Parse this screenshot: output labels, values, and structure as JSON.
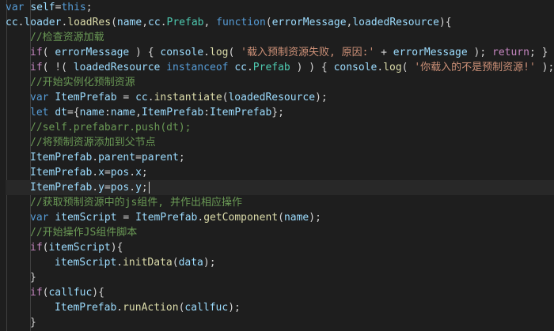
{
  "editor": {
    "theme_colors": {
      "background": "#1e1e1e",
      "keyword": "#569cd6",
      "control": "#c586c0",
      "function": "#dcdcaa",
      "variable": "#9cdcfe",
      "class": "#4ec9b0",
      "string": "#ce9178",
      "comment": "#6a9955",
      "punctuation": "#d4d4d4"
    },
    "cursor_line": 12,
    "lines": [
      {
        "indent": 0,
        "tokens": [
          [
            "kw",
            "var"
          ],
          [
            "p",
            " "
          ],
          [
            "var",
            "self"
          ],
          [
            "p",
            "="
          ],
          [
            "kw",
            "this"
          ],
          [
            "p",
            ";"
          ]
        ]
      },
      {
        "indent": 0,
        "tokens": [
          [
            "var",
            "cc"
          ],
          [
            "p",
            "."
          ],
          [
            "var",
            "loader"
          ],
          [
            "p",
            "."
          ],
          [
            "fn",
            "loadRes"
          ],
          [
            "p",
            "("
          ],
          [
            "var",
            "name"
          ],
          [
            "p",
            ","
          ],
          [
            "var",
            "cc"
          ],
          [
            "p",
            "."
          ],
          [
            "cls",
            "Prefab"
          ],
          [
            "p",
            ", "
          ],
          [
            "kw",
            "function"
          ],
          [
            "p",
            "("
          ],
          [
            "var",
            "errorMessage"
          ],
          [
            "p",
            ","
          ],
          [
            "var",
            "loadedResource"
          ],
          [
            "p",
            "){"
          ]
        ]
      },
      {
        "indent": 1,
        "tokens": [
          [
            "cmt",
            "//检查资源加载"
          ]
        ]
      },
      {
        "indent": 1,
        "tokens": [
          [
            "ctl",
            "if"
          ],
          [
            "p",
            "( "
          ],
          [
            "var",
            "errorMessage"
          ],
          [
            "p",
            " ) { "
          ],
          [
            "var",
            "console"
          ],
          [
            "p",
            "."
          ],
          [
            "fn",
            "log"
          ],
          [
            "p",
            "( "
          ],
          [
            "str",
            "'载入预制资源失败, 原因:'"
          ],
          [
            "p",
            " + "
          ],
          [
            "var",
            "errorMessage"
          ],
          [
            "p",
            " ); "
          ],
          [
            "ctl",
            "return"
          ],
          [
            "p",
            "; }"
          ]
        ]
      },
      {
        "indent": 1,
        "tokens": [
          [
            "ctl",
            "if"
          ],
          [
            "p",
            "( !( "
          ],
          [
            "var",
            "loadedResource"
          ],
          [
            "p",
            " "
          ],
          [
            "kw",
            "instanceof"
          ],
          [
            "p",
            " "
          ],
          [
            "var",
            "cc"
          ],
          [
            "p",
            "."
          ],
          [
            "cls",
            "Prefab"
          ],
          [
            "p",
            " ) ) { "
          ],
          [
            "var",
            "console"
          ],
          [
            "p",
            "."
          ],
          [
            "fn",
            "log"
          ],
          [
            "p",
            "( "
          ],
          [
            "str",
            "'你载入的不是预制资源!'"
          ],
          [
            "p",
            " );"
          ]
        ]
      },
      {
        "indent": 1,
        "tokens": [
          [
            "cmt",
            "//开始实例化预制资源"
          ]
        ]
      },
      {
        "indent": 1,
        "tokens": [
          [
            "kw",
            "var"
          ],
          [
            "p",
            " "
          ],
          [
            "var",
            "ItemPrefab"
          ],
          [
            "p",
            " = "
          ],
          [
            "var",
            "cc"
          ],
          [
            "p",
            "."
          ],
          [
            "fn",
            "instantiate"
          ],
          [
            "p",
            "("
          ],
          [
            "var",
            "loadedResource"
          ],
          [
            "p",
            ");"
          ]
        ]
      },
      {
        "indent": 1,
        "tokens": [
          [
            "kw",
            "let"
          ],
          [
            "p",
            " "
          ],
          [
            "var",
            "dt"
          ],
          [
            "p",
            "={"
          ],
          [
            "var",
            "name"
          ],
          [
            "p",
            ":"
          ],
          [
            "var",
            "name"
          ],
          [
            "p",
            ","
          ],
          [
            "var",
            "ItemPrefab"
          ],
          [
            "p",
            ":"
          ],
          [
            "var",
            "ItemPrefab"
          ],
          [
            "p",
            "};"
          ]
        ]
      },
      {
        "indent": 1,
        "tokens": [
          [
            "cmt",
            "//self.prefabarr.push(dt);"
          ]
        ]
      },
      {
        "indent": 1,
        "tokens": [
          [
            "cmt",
            "//将预制资源添加到父节点"
          ]
        ]
      },
      {
        "indent": 1,
        "tokens": [
          [
            "var",
            "ItemPrefab"
          ],
          [
            "p",
            "."
          ],
          [
            "var",
            "parent"
          ],
          [
            "p",
            "="
          ],
          [
            "var",
            "parent"
          ],
          [
            "p",
            ";"
          ]
        ]
      },
      {
        "indent": 1,
        "tokens": [
          [
            "var",
            "ItemPrefab"
          ],
          [
            "p",
            "."
          ],
          [
            "var",
            "x"
          ],
          [
            "p",
            "="
          ],
          [
            "var",
            "pos"
          ],
          [
            "p",
            "."
          ],
          [
            "var",
            "x"
          ],
          [
            "p",
            ";"
          ]
        ]
      },
      {
        "indent": 1,
        "tokens": [
          [
            "var",
            "ItemPrefab"
          ],
          [
            "p",
            "."
          ],
          [
            "var",
            "y"
          ],
          [
            "p",
            "="
          ],
          [
            "var",
            "pos"
          ],
          [
            "p",
            "."
          ],
          [
            "var",
            "y"
          ],
          [
            "p",
            ";"
          ]
        ]
      },
      {
        "indent": 1,
        "tokens": [
          [
            "cmt",
            "//获取预制资源中的js组件, 并作出相应操作"
          ]
        ]
      },
      {
        "indent": 1,
        "tokens": [
          [
            "kw",
            "var"
          ],
          [
            "p",
            " "
          ],
          [
            "var",
            "itemScript"
          ],
          [
            "p",
            " = "
          ],
          [
            "var",
            "ItemPrefab"
          ],
          [
            "p",
            "."
          ],
          [
            "fn",
            "getComponent"
          ],
          [
            "p",
            "("
          ],
          [
            "var",
            "name"
          ],
          [
            "p",
            ");"
          ]
        ]
      },
      {
        "indent": 1,
        "tokens": [
          [
            "cmt",
            "//开始操作JS组件脚本"
          ]
        ]
      },
      {
        "indent": 1,
        "tokens": [
          [
            "ctl",
            "if"
          ],
          [
            "p",
            "("
          ],
          [
            "var",
            "itemScript"
          ],
          [
            "p",
            "){"
          ]
        ]
      },
      {
        "indent": 2,
        "tokens": [
          [
            "var",
            "itemScript"
          ],
          [
            "p",
            "."
          ],
          [
            "fn",
            "initData"
          ],
          [
            "p",
            "("
          ],
          [
            "var",
            "data"
          ],
          [
            "p",
            ");"
          ]
        ]
      },
      {
        "indent": 1,
        "tokens": [
          [
            "p",
            "}"
          ]
        ]
      },
      {
        "indent": 1,
        "tokens": [
          [
            "ctl",
            "if"
          ],
          [
            "p",
            "("
          ],
          [
            "var",
            "callfuc"
          ],
          [
            "p",
            "){"
          ]
        ]
      },
      {
        "indent": 2,
        "tokens": [
          [
            "var",
            "ItemPrefab"
          ],
          [
            "p",
            "."
          ],
          [
            "fn",
            "runAction"
          ],
          [
            "p",
            "("
          ],
          [
            "var",
            "callfuc"
          ],
          [
            "p",
            ");"
          ]
        ]
      },
      {
        "indent": 1,
        "tokens": [
          [
            "p",
            "}"
          ]
        ]
      }
    ]
  }
}
